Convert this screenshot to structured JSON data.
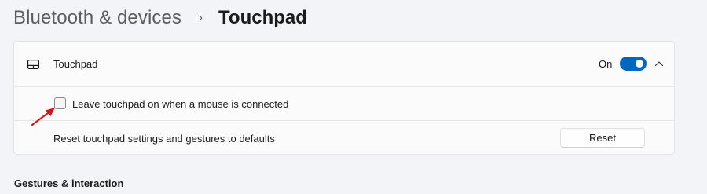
{
  "breadcrumb": {
    "parent": "Bluetooth & devices",
    "separator": "›",
    "current": "Touchpad"
  },
  "touchpad_card": {
    "icon": "touchpad-icon",
    "label": "Touchpad",
    "toggle_state_label": "On",
    "toggle_on": true,
    "expand_icon": "chevron-up-icon"
  },
  "leave_touchpad": {
    "label": "Leave touchpad on when a mouse is connected",
    "checked": false
  },
  "reset_row": {
    "label": "Reset touchpad settings and gestures to defaults",
    "button_label": "Reset"
  },
  "gestures_section": {
    "title": "Gestures & interaction"
  },
  "annotation": {
    "icon": "red-arrow-icon",
    "color": "#d4151c"
  },
  "colors": {
    "accent": "#0067c0",
    "background": "#f3f4f8",
    "card": "#fbfbfb"
  }
}
